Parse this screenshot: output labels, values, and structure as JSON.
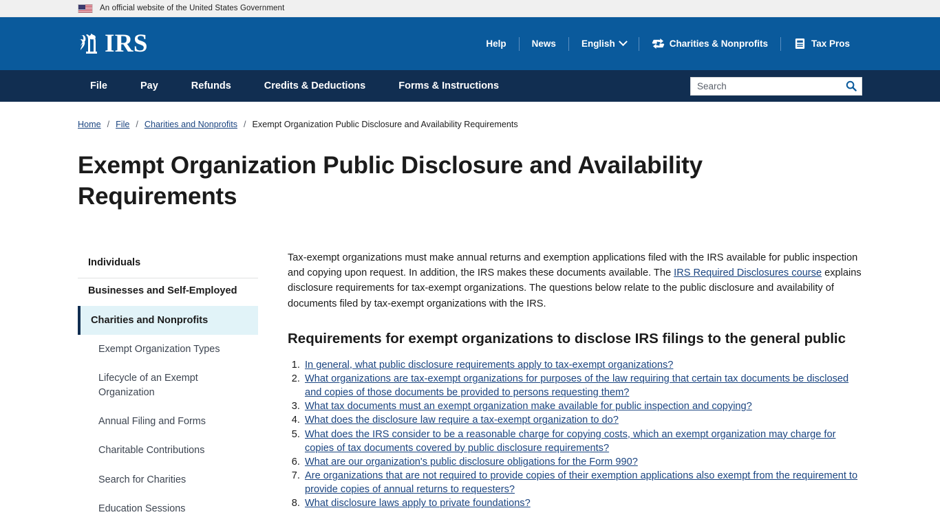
{
  "gov_banner": {
    "text": "An official website of the United States Government",
    "flag_icon": "us-flag-icon"
  },
  "header": {
    "logo_text": "IRS",
    "logo_emblem_icon": "irs-eagle-scales-emblem",
    "utility_nav": [
      {
        "label": "Help",
        "icon": null
      },
      {
        "label": "News",
        "icon": null
      },
      {
        "label": "English",
        "icon": "chevron-down-icon"
      },
      {
        "label": "Charities & Nonprofits",
        "icon": "charities-nonprofits-icon"
      },
      {
        "label": "Tax Pros",
        "icon": "tax-pros-book-icon"
      }
    ]
  },
  "nav": {
    "items": [
      {
        "label": "File"
      },
      {
        "label": "Pay"
      },
      {
        "label": "Refunds"
      },
      {
        "label": "Credits & Deductions"
      },
      {
        "label": "Forms & Instructions"
      }
    ]
  },
  "search": {
    "placeholder": "Search",
    "value": "",
    "icon": "search-icon"
  },
  "breadcrumb": {
    "items": [
      {
        "label": "Home",
        "link": true
      },
      {
        "label": "File",
        "link": true
      },
      {
        "label": "Charities and Nonprofits",
        "link": true
      },
      {
        "label": "Exempt Organization Public Disclosure and Availability Requirements",
        "link": false
      }
    ],
    "separator": "/"
  },
  "page": {
    "title": "Exempt Organization Public Disclosure and Availability Requirements"
  },
  "sidebar": {
    "top_items": [
      {
        "label": "Individuals",
        "active": false
      },
      {
        "label": "Businesses and Self-Employed",
        "active": false
      },
      {
        "label": "Charities and Nonprofits",
        "active": true
      }
    ],
    "sub_items": [
      {
        "label": "Exempt Organization Types"
      },
      {
        "label": "Lifecycle of an Exempt Organization"
      },
      {
        "label": "Annual Filing and Forms"
      },
      {
        "label": "Charitable Contributions"
      },
      {
        "label": "Search for Charities"
      },
      {
        "label": "Education Sessions"
      }
    ]
  },
  "main": {
    "intro": {
      "part1": "Tax-exempt organizations must make annual returns and exemption applications filed with the IRS available for public inspection and copying upon request. In addition, the IRS makes these documents available. The ",
      "link": "IRS Required Disclosures course",
      "part2": " explains disclosure requirements for tax-exempt organizations. The questions below relate to the public disclosure and availability of documents filed by tax-exempt organizations with the IRS."
    },
    "section_heading": "Requirements for exempt organizations to disclose IRS filings to the general public",
    "questions": [
      "In general, what public disclosure requirements apply to tax-exempt organizations?",
      "What organizations are tax-exempt organizations for purposes of the law requiring that certain tax documents be disclosed and copies of those documents be provided to persons requesting them?",
      "What tax documents must an exempt organization make available for public inspection and copying?",
      "What does the disclosure law require a tax-exempt organization to do?",
      "What does the IRS consider to be a reasonable charge for copying costs, which an exempt organization may charge for copies of tax documents covered by public disclosure requirements?",
      "What are our organization's public disclosure obligations for the Form 990?",
      "Are organizations that are not required to provide copies of their exemption applications also exempt from the requirement to provide copies of annual returns to requesters?",
      "What disclosure laws apply to private foundations?"
    ]
  },
  "colors": {
    "header_blue": "#0a5a9c",
    "nav_navy": "#112e51",
    "link_blue": "#1a4480",
    "active_bg": "#e1f3f8",
    "banner_gray": "#f0f0f0"
  }
}
